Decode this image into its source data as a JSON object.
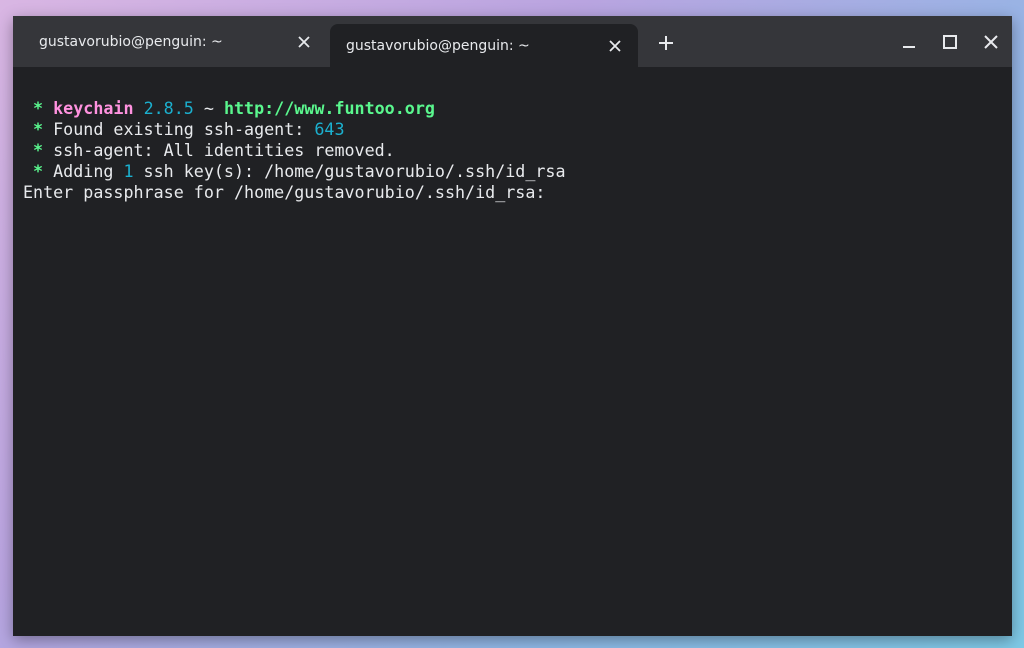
{
  "window": {
    "tabs": [
      {
        "title": "gustavorubio@penguin: ~",
        "active": false
      },
      {
        "title": "gustavorubio@penguin: ~",
        "active": true
      }
    ]
  },
  "icons": {
    "tab_close": "close-icon",
    "new_tab": "plus-icon",
    "minimize": "minimize-icon",
    "maximize": "maximize-icon",
    "close": "close-icon"
  },
  "colors": {
    "background": "#202124",
    "titlebar": "#35363a",
    "green": "#5af78e",
    "pink": "#ff92df",
    "cyan": "#1bb0cf",
    "text": "#e8eaed"
  },
  "terminal": {
    "line1": {
      "star": "*",
      "app": "keychain",
      "version": "2.8.5",
      "sep": "~",
      "url": "http://www.funtoo.org"
    },
    "line2": {
      "star": "*",
      "text": "Found existing ssh-agent: ",
      "pid": "643"
    },
    "line3": {
      "star": "*",
      "text": "ssh-agent: All identities removed."
    },
    "line4": {
      "star": "*",
      "text_before": "Adding ",
      "count": "1",
      "text_after": " ssh key(s): /home/gustavorubio/.ssh/id_rsa"
    },
    "line5": {
      "text": "Enter passphrase for /home/gustavorubio/.ssh/id_rsa:"
    }
  }
}
